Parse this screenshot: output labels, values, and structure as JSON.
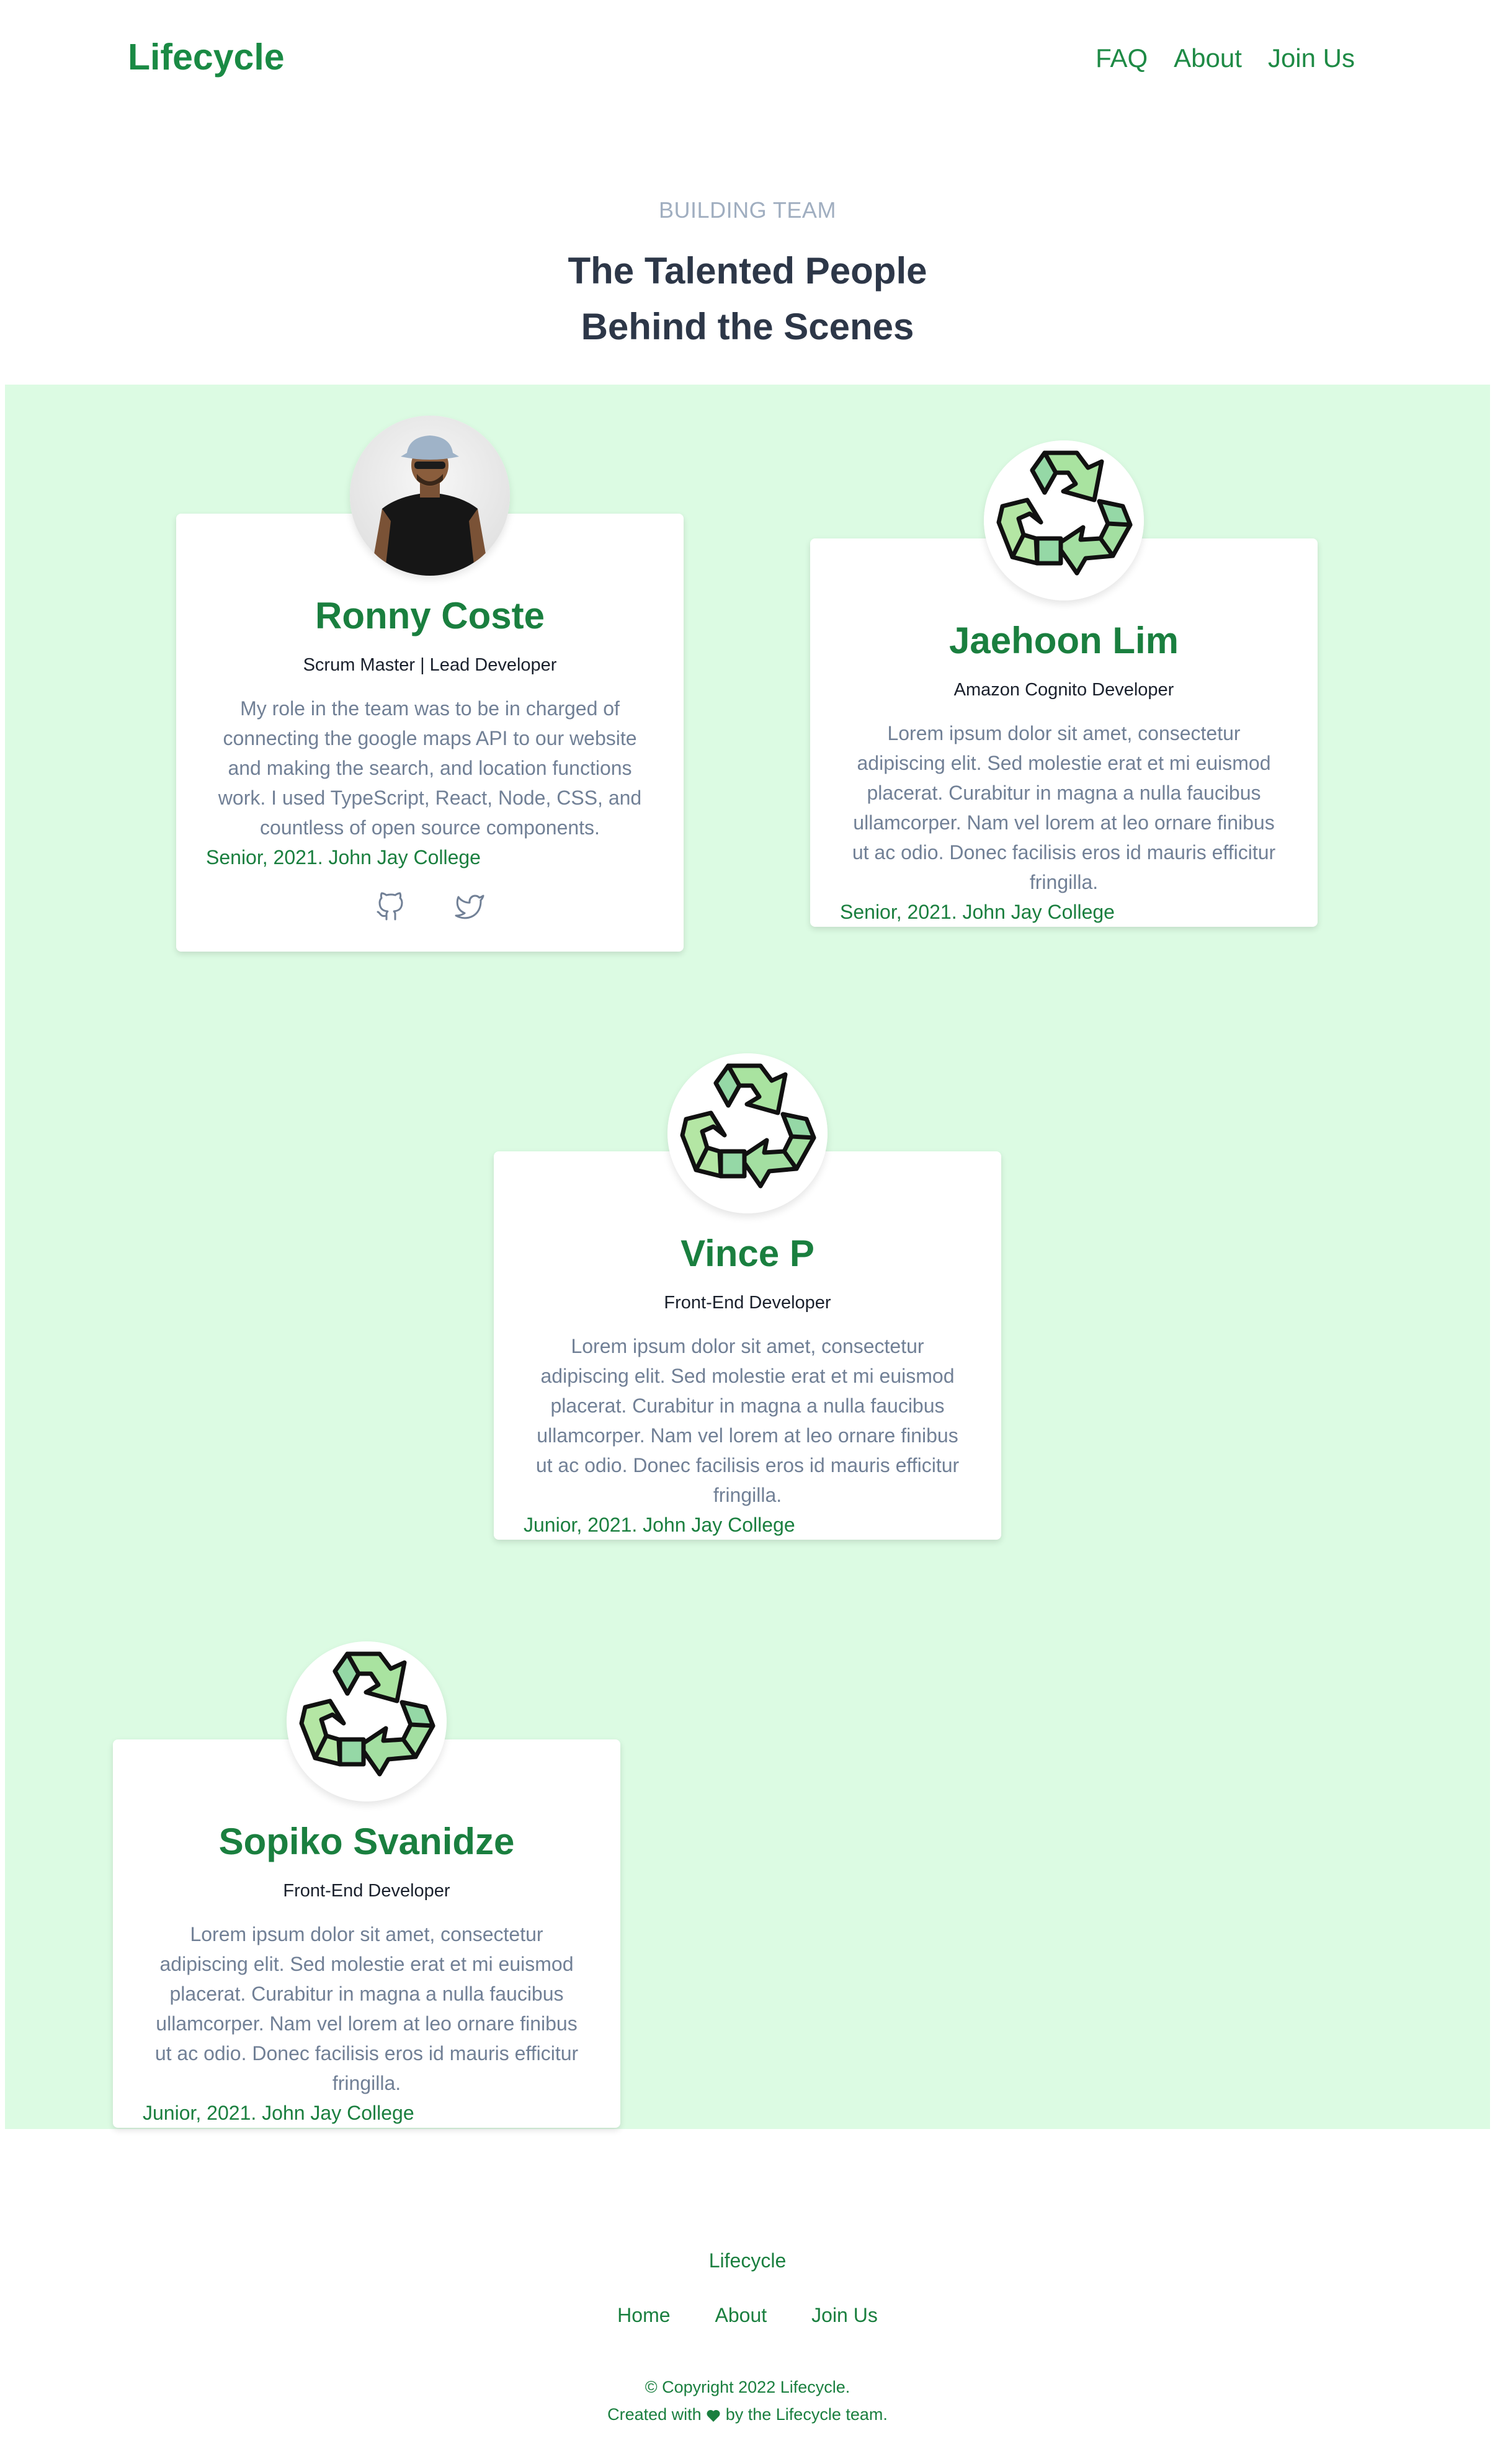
{
  "header": {
    "logo": "Lifecycle",
    "nav": [
      "FAQ",
      "About",
      "Join Us"
    ]
  },
  "intro": {
    "eyebrow": "BUILDING TEAM",
    "title_line1": "The Talented People",
    "title_line2": "Behind the Scenes"
  },
  "team": [
    {
      "name": "Ronny Coste",
      "role": "Scrum Master | Lead Developer",
      "bio": "My role in the team was to be in charged of connecting the google maps API to our website and making the search, and location functions work. I used TypeScript, React, Node, CSS, and countless of open source components.",
      "school": "Senior, 2021. John Jay College",
      "avatar": "photo",
      "socials": [
        "github-icon",
        "twitter-icon"
      ]
    },
    {
      "name": "Jaehoon Lim",
      "role": "Amazon Cognito Developer",
      "bio": "Lorem ipsum dolor sit amet, consectetur adipiscing elit. Sed molestie erat et mi euismod placerat. Curabitur in magna a nulla faucibus ullamcorper. Nam vel lorem at leo ornare finibus ut ac odio. Donec facilisis eros id mauris efficitur fringilla.",
      "school": "Senior, 2021. John Jay College",
      "avatar": "recycle-icon"
    },
    {
      "name": "Vince P",
      "role": "Front-End Developer",
      "bio": "Lorem ipsum dolor sit amet, consectetur adipiscing elit. Sed molestie erat et mi euismod placerat. Curabitur in magna a nulla faucibus ullamcorper. Nam vel lorem at leo ornare finibus ut ac odio. Donec facilisis eros id mauris efficitur fringilla.",
      "school": "Junior, 2021. John Jay College",
      "avatar": "recycle-icon"
    },
    {
      "name": "Sopiko Svanidze",
      "role": "Front-End Developer",
      "bio": "Lorem ipsum dolor sit amet, consectetur adipiscing elit. Sed molestie erat et mi euismod placerat. Curabitur in magna a nulla faucibus ullamcorper. Nam vel lorem at leo ornare finibus ut ac odio. Donec facilisis eros id mauris efficitur fringilla.",
      "school": "Junior, 2021. John Jay College",
      "avatar": "recycle-icon"
    }
  ],
  "footer": {
    "brand": "Lifecycle",
    "nav": [
      "Home",
      "About",
      "Join Us"
    ],
    "copyright": "© Copyright 2022 Lifecycle.",
    "created_before": "Created with",
    "created_after": "by the Lifecycle team."
  },
  "colors": {
    "brand_green": "#1a7f3f",
    "band_background": "#dcfbe3",
    "muted_text": "#718096",
    "heading_text": "#2d3748"
  }
}
